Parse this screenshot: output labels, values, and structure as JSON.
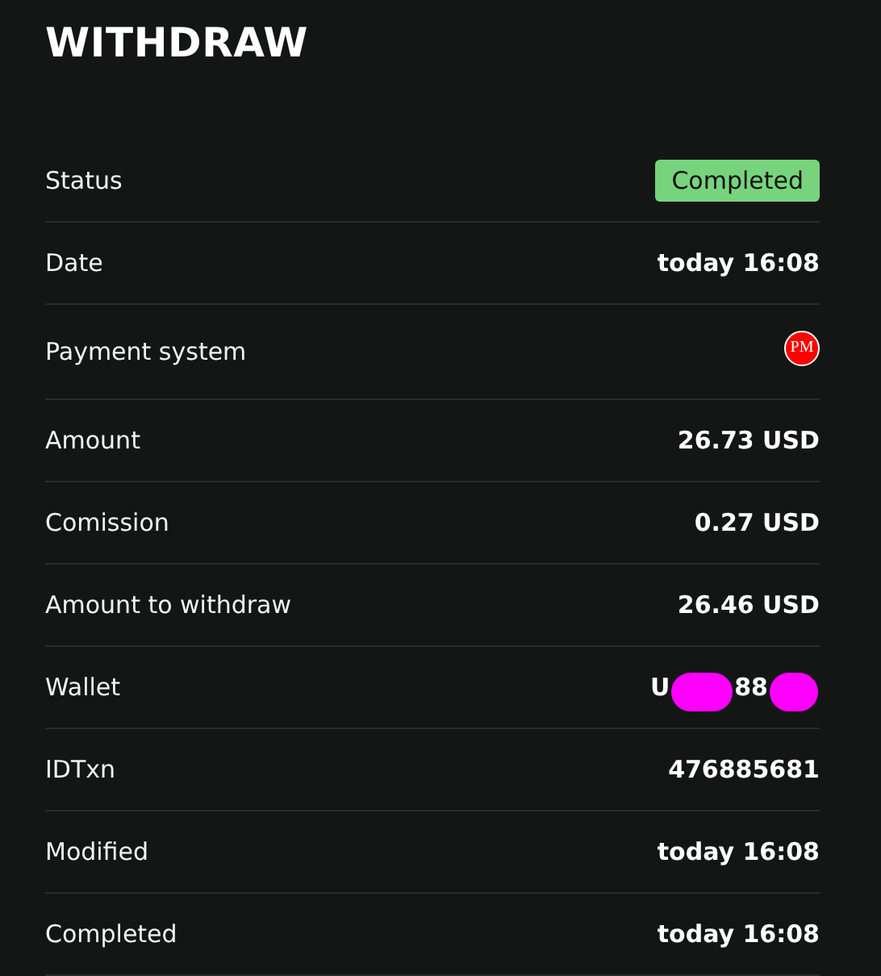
{
  "title": "WITHDRAW",
  "rows": [
    {
      "label": "Status",
      "kind": "badge",
      "value": "Completed"
    },
    {
      "label": "Date",
      "kind": "text",
      "value": "today 16:08"
    },
    {
      "label": "Payment system",
      "kind": "logo",
      "value": "PM"
    },
    {
      "label": "Amount",
      "kind": "text",
      "value": "26.73 USD"
    },
    {
      "label": "Comission",
      "kind": "text",
      "value": "0.27 USD"
    },
    {
      "label": "Amount to withdraw",
      "kind": "text",
      "value": "26.46 USD"
    },
    {
      "label": "Wallet",
      "kind": "redacted",
      "parts": [
        {
          "kind": "text",
          "text": "U"
        },
        {
          "kind": "redaction"
        },
        {
          "kind": "text",
          "text": "88"
        },
        {
          "kind": "redaction"
        }
      ]
    },
    {
      "label": "IDTxn",
      "kind": "text",
      "value": "476885681"
    },
    {
      "label": "Modified",
      "kind": "text",
      "value": "today 16:08"
    },
    {
      "label": "Completed",
      "kind": "text",
      "value": "today 16:08"
    }
  ]
}
